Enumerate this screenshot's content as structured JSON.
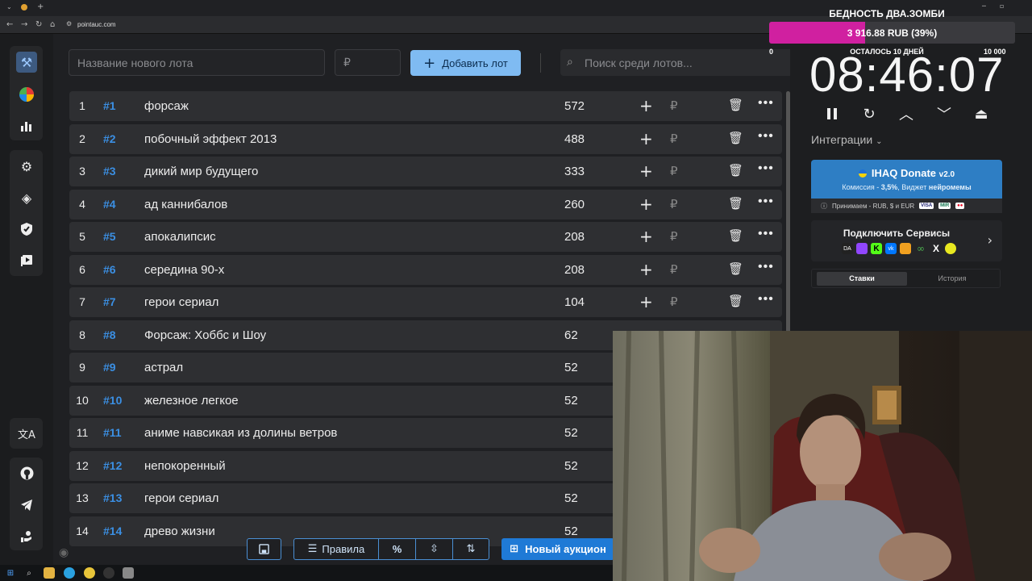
{
  "browser": {
    "url": "pointauc.com"
  },
  "add_lot": {
    "name_placeholder": "Название нового лота",
    "amount_placeholder": "₽",
    "add_button": "Добавить лот",
    "search_placeholder": "Поиск среди лотов..."
  },
  "lots": [
    {
      "index": "1",
      "tag": "#1",
      "name": "форсаж",
      "amount": "572"
    },
    {
      "index": "2",
      "tag": "#2",
      "name": "побочный эффект 2013",
      "amount": "488"
    },
    {
      "index": "3",
      "tag": "#3",
      "name": "дикий мир будущего",
      "amount": "333"
    },
    {
      "index": "4",
      "tag": "#4",
      "name": "ад каннибалов",
      "amount": "260"
    },
    {
      "index": "5",
      "tag": "#5",
      "name": "апокалипсис",
      "amount": "208"
    },
    {
      "index": "6",
      "tag": "#6",
      "name": "середина 90-х",
      "amount": "208"
    },
    {
      "index": "7",
      "tag": "#7",
      "name": "герои сериал",
      "amount": "104"
    },
    {
      "index": "8",
      "tag": "#8",
      "name": "Форсаж: Хоббс и Шоу",
      "amount": "62"
    },
    {
      "index": "9",
      "tag": "#9",
      "name": "астрал",
      "amount": "52"
    },
    {
      "index": "10",
      "tag": "#10",
      "name": "железное легкое",
      "amount": "52"
    },
    {
      "index": "11",
      "tag": "#11",
      "name": "аниме навсикая из долины ветров",
      "amount": "52"
    },
    {
      "index": "12",
      "tag": "#12",
      "name": "непокоренный",
      "amount": "52"
    },
    {
      "index": "13",
      "tag": "#13",
      "name": "герои сериал",
      "amount": "52"
    },
    {
      "index": "14",
      "tag": "#14",
      "name": "древо жизни",
      "amount": "52"
    }
  ],
  "row_actions": {
    "currency": "₽"
  },
  "toolbar": {
    "rules": "Правила",
    "percent": "%",
    "new_auction": "Новый аукцион"
  },
  "goal": {
    "title": "БЕДНОСТЬ ДВА.ЗОМБИ",
    "progress_text": "3 916.88 RUB (39%)",
    "progress_fraction": 0.39,
    "min": "0",
    "remaining": "ОСТАЛОСЬ 10 ДНЕЙ",
    "max": "10 000"
  },
  "timer": "08:46:07",
  "integrations": {
    "label": "Интеграции",
    "donate_title": "IHAQ Donate",
    "donate_version": "v2.0",
    "donate_desc_1": "Комиссия - ",
    "donate_desc_pct": "3,5%",
    "donate_desc_2": ", Виджет ",
    "donate_desc_bold": "нейромемы",
    "donate_accepts": "Принимаем - RUB, $ и EUR",
    "services_title": "Подключить Сервисы",
    "tab_bets": "Ставки",
    "tab_history": "История"
  },
  "colors": {
    "accent": "#3b8fe3",
    "goal_fill": "#d020a0",
    "donate_bg": "#2e7ec4"
  }
}
